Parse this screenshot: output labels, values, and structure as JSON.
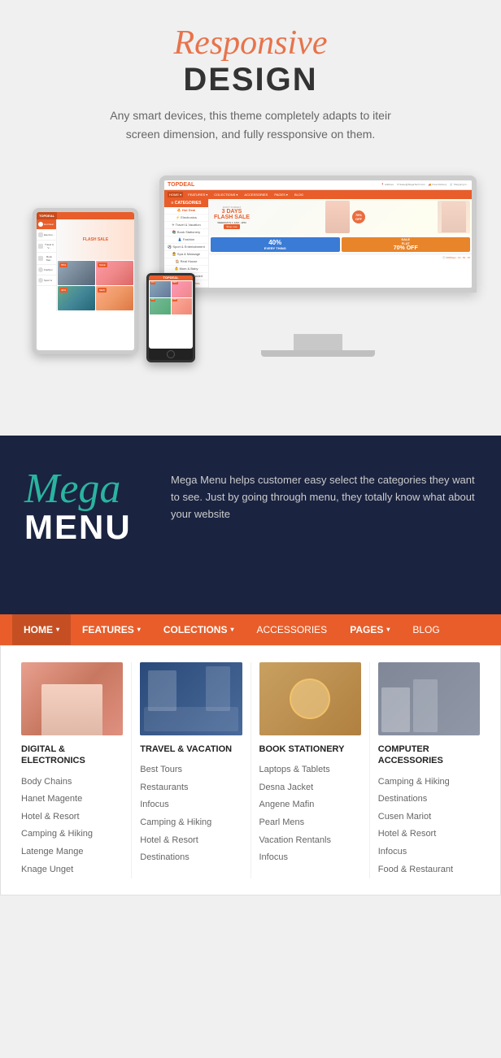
{
  "hero": {
    "title_cursive": "Responsive",
    "title_bold": "DESIGN",
    "subtitle": "Any smart devices, this theme completely adapts to iteir screen dimension, and fully ressponsive on them."
  },
  "website_mockup": {
    "logo": "TOPDEAL",
    "nav_items": [
      "HOME",
      "FEATURES",
      "COLECTIONS",
      "ACCESSORIES",
      "PAGES",
      "BLOG"
    ],
    "sidebar_header": "CATEGORIES",
    "sidebar_items": [
      "Hot Deal",
      "Electronics",
      "Travel & Vacation",
      "Book Stationery",
      "Fashion",
      "Sport & Entertainment",
      "Spa & Massage",
      "Real House",
      "Mom & Baby",
      "Food & Restaurant",
      "More Categories"
    ],
    "flash_label": "DON'T FORGET",
    "flash_title": "3 DAYS FLASH SALE",
    "shop_btn": "Shop now",
    "discount": "75%",
    "promo_40": "40%",
    "promo_sale": "SALE\nFLAT\n70% OFF"
  },
  "mega_section": {
    "title_cursive": "Mega",
    "title_bold": "MENU",
    "description": "Mega Menu helps customer easy select the categories they want to see. Just by going through menu, they totally know what about your website"
  },
  "menu_bar": {
    "items": [
      {
        "label": "HOME",
        "arrow": true
      },
      {
        "label": "FEATURES",
        "arrow": true
      },
      {
        "label": "COLECTIONS",
        "arrow": true
      },
      {
        "label": "ACCESSORIES",
        "arrow": false
      },
      {
        "label": "PAGES",
        "arrow": true
      },
      {
        "label": "BLOG",
        "arrow": false
      }
    ]
  },
  "mega_menu": {
    "columns": [
      {
        "title": "DIGITAL & ELECTRONICS",
        "links": [
          "Body Chains",
          "Hanet Magente",
          "Hotel & Resort",
          "Camping & Hiking",
          "Latenge Mange",
          "Knage Unget"
        ]
      },
      {
        "title": "TRAVEL & VACATION",
        "links": [
          "Best Tours",
          "Restaurants",
          "Infocus",
          "Camping & Hiking",
          "Hotel & Resort",
          "Destinations"
        ]
      },
      {
        "title": "BOOK STATIONERY",
        "links": [
          "Laptops & Tablets",
          "Desna Jacket",
          "Angene Mafin",
          "Pearl Mens",
          "Vacation Rentanls",
          "Infocus"
        ]
      },
      {
        "title": "COMPUTER ACCESSORIES",
        "links": [
          "Camping & Hiking",
          "Destinations",
          "Cusen Mariot",
          "Hotel & Resort",
          "Infocus",
          "Food & Restaurant"
        ]
      }
    ]
  },
  "sidebar_nav": {
    "items": [
      {
        "icon": "flame-icon",
        "label": "Hot Deal",
        "active": true
      },
      {
        "icon": "electronics-icon",
        "label": "Electronics"
      },
      {
        "icon": "travel-icon",
        "label": "Travel & Vac..."
      },
      {
        "icon": "book-icon",
        "label": "Book Station..."
      },
      {
        "icon": "fashion-icon",
        "label": "Fashion"
      },
      {
        "icon": "sport-icon",
        "label": "Sport &..."
      }
    ]
  },
  "colors": {
    "orange": "#e85d2a",
    "dark_navy": "#1a2340",
    "teal": "#2ab4a0",
    "light_gray": "#f0f0f0"
  }
}
